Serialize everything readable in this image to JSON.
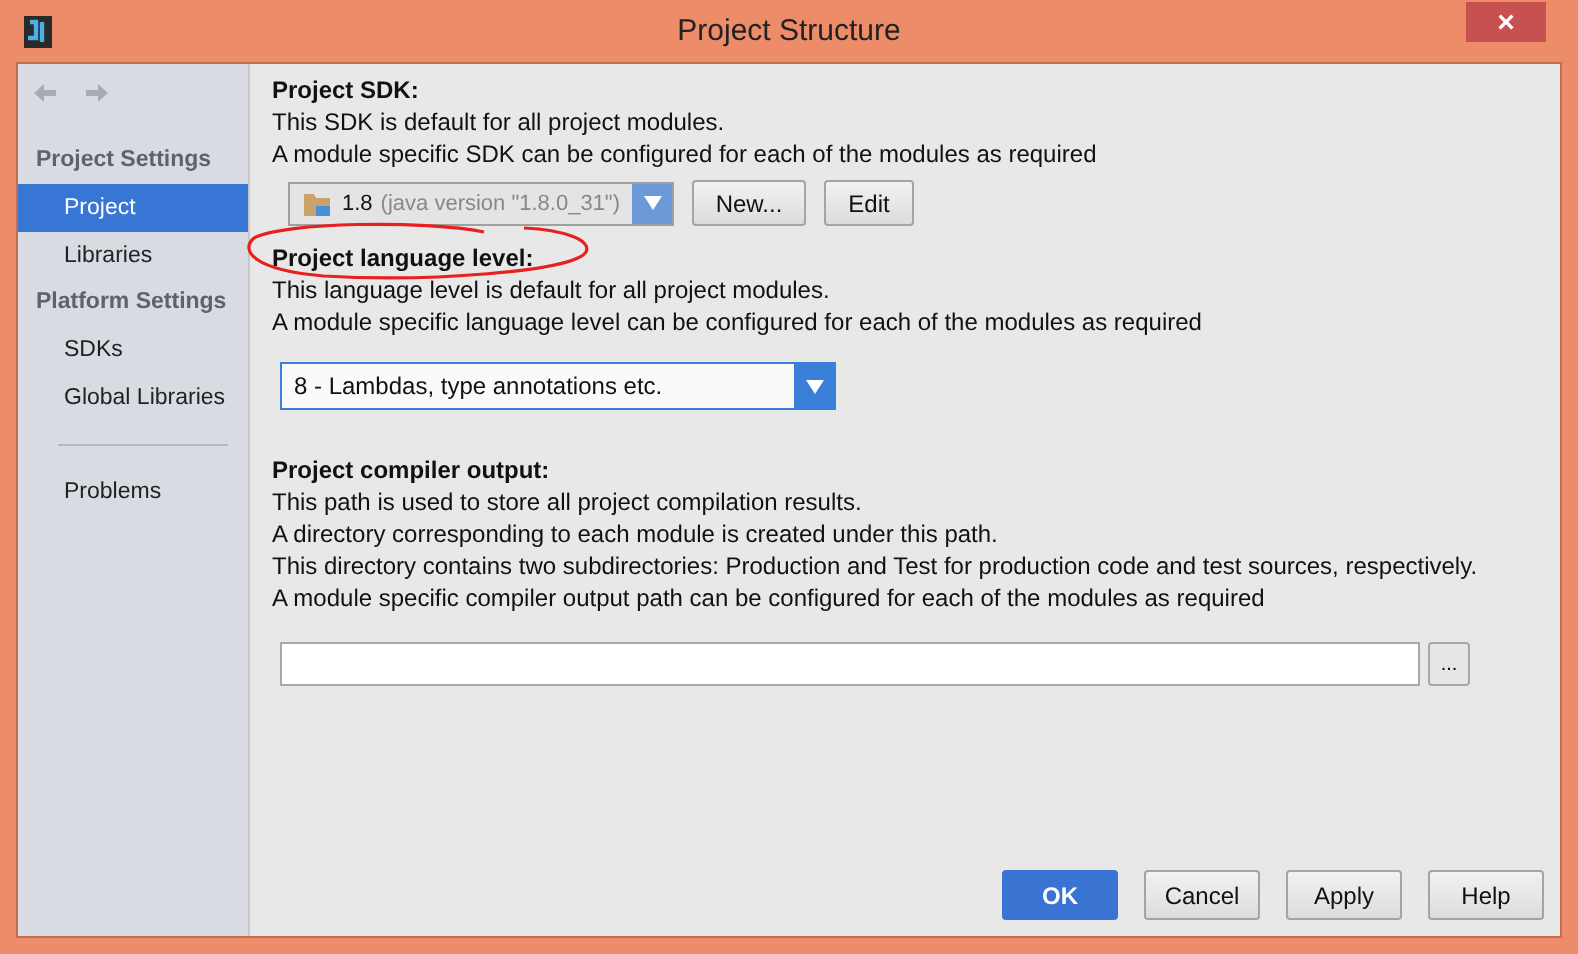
{
  "window": {
    "title": "Project Structure",
    "close": "×"
  },
  "sidebar": {
    "groups": [
      {
        "heading": "Project Settings",
        "items": [
          {
            "label": "Project",
            "selected": true
          },
          {
            "label": "Libraries",
            "selected": false
          }
        ]
      },
      {
        "heading": "Platform Settings",
        "items": [
          {
            "label": "SDKs",
            "selected": false
          },
          {
            "label": "Global Libraries",
            "selected": false
          }
        ]
      },
      {
        "items": [
          {
            "label": "Problems",
            "selected": false
          }
        ]
      }
    ]
  },
  "sections": [
    {
      "kind": "sdk",
      "title": "Project SDK:",
      "circled": false,
      "lines": [
        "This SDK is default for all project modules.",
        "A module specific SDK can be configured for each of the modules as required"
      ],
      "combo": {
        "value": "1.8",
        "detail": "(java version \"1.8.0_31\")"
      },
      "buttons": [
        "New...",
        "Edit"
      ]
    },
    {
      "kind": "language",
      "title": "Project language level:",
      "circled": true,
      "lines": [
        "This language level is default for all project modules.",
        "A module specific language level can be configured for each of the modules as required"
      ],
      "combo": {
        "value": "8 - Lambdas, type annotations etc."
      }
    },
    {
      "kind": "output",
      "title": "Project compiler output:",
      "circled": false,
      "lines": [
        "This path is used to store all project compilation results.",
        "A directory corresponding to each module is created under this path.",
        "This directory contains two subdirectories: Production and Test for production code and test sources, respectively.",
        "A module specific compiler output path can be configured for each of the modules as required"
      ],
      "browse": "..."
    }
  ],
  "buttons": [
    {
      "label": "OK",
      "default": true
    },
    {
      "label": "Cancel",
      "default": false
    },
    {
      "label": "Apply",
      "default": false
    },
    {
      "label": "Help",
      "default": false
    }
  ]
}
